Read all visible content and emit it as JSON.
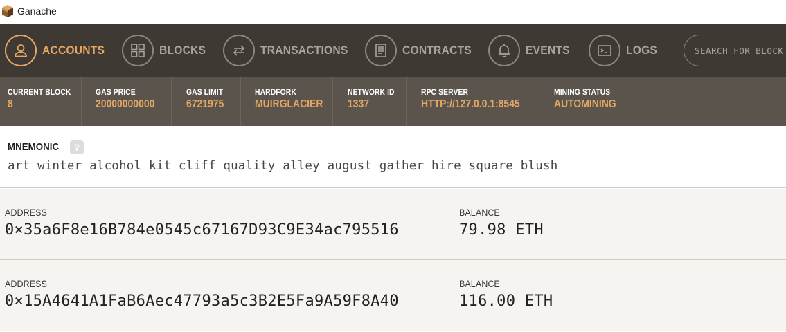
{
  "window": {
    "title": "Ganache"
  },
  "nav": {
    "items": [
      {
        "label": "ACCOUNTS",
        "icon": "user-icon",
        "active": true
      },
      {
        "label": "BLOCKS",
        "icon": "blocks-icon",
        "active": false
      },
      {
        "label": "TRANSACTIONS",
        "icon": "transfer-arrows-icon",
        "active": false
      },
      {
        "label": "CONTRACTS",
        "icon": "document-icon",
        "active": false
      },
      {
        "label": "EVENTS",
        "icon": "bell-icon",
        "active": false
      },
      {
        "label": "LOGS",
        "icon": "terminal-icon",
        "active": false
      }
    ],
    "search_placeholder": "SEARCH FOR BLOCK NUMBERS OR TX HASHES"
  },
  "status": [
    {
      "label": "CURRENT BLOCK",
      "value": "8"
    },
    {
      "label": "GAS PRICE",
      "value": "20000000000"
    },
    {
      "label": "GAS LIMIT",
      "value": "6721975"
    },
    {
      "label": "HARDFORK",
      "value": "MUIRGLACIER"
    },
    {
      "label": "NETWORK ID",
      "value": "1337"
    },
    {
      "label": "RPC SERVER",
      "value": "HTTP://127.0.0.1:8545"
    },
    {
      "label": "MINING STATUS",
      "value": "AUTOMINING"
    }
  ],
  "mnemonic": {
    "label": "MNEMONIC",
    "help": "?",
    "words": "art winter alcohol kit cliff quality alley august gather hire square blush"
  },
  "accounts": [
    {
      "address_label": "ADDRESS",
      "address": "0×35a6F8e16B784e0545c67167D93C9E34ac795516",
      "balance_label": "BALANCE",
      "balance": "79.98 ETH"
    },
    {
      "address_label": "ADDRESS",
      "address": "0×15A4641A1FaB6Aec47793a5c3B2E5Fa9A59F8A40",
      "balance_label": "BALANCE",
      "balance": "116.00 ETH"
    }
  ],
  "colors": {
    "accent": "#e4a663",
    "nav_bg": "#3e3933",
    "status_bg": "#5b544d",
    "account_bg": "#f6f4f0"
  }
}
